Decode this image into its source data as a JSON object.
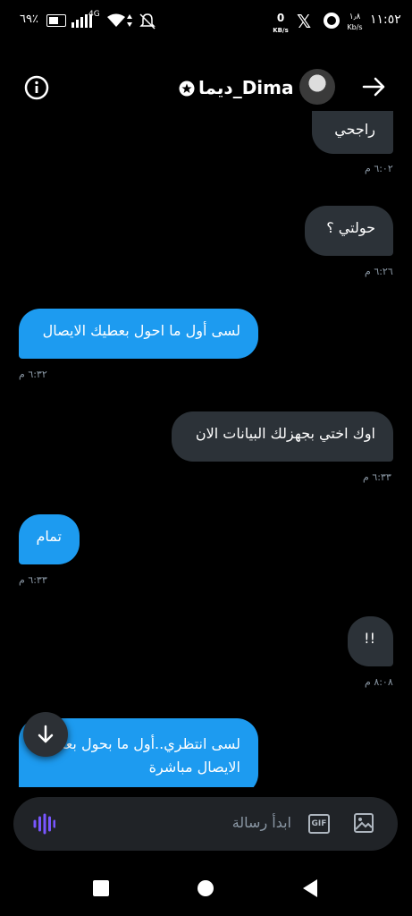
{
  "status_bar": {
    "time": "١١:٥٢",
    "data_speed_value": "١٫٨",
    "data_speed_unit": "Kb/s",
    "data_speed_value2": "0",
    "data_speed_unit2": "KB/s",
    "network": "4G",
    "battery": "٦٩٪"
  },
  "header": {
    "name": "ديما_Dima",
    "info_icon": "info-icon",
    "back_icon": "arrow-right-icon"
  },
  "messages": [
    {
      "dir": "out",
      "text": "راجحي",
      "time": "٦:٠٢ م"
    },
    {
      "dir": "out",
      "text": "حولتي ؟",
      "time": "٦:٢٦ م"
    },
    {
      "dir": "in",
      "text": "لسى أول ما احول بعطيك الايصال",
      "time": "٦:٣٢ م"
    },
    {
      "dir": "out",
      "text": "اوك اختي بجهزلك البيانات الان",
      "time": "٦:٣٣ م"
    },
    {
      "dir": "in",
      "text": "تمام",
      "time": "٦:٣٣ م"
    },
    {
      "dir": "out",
      "text": "!!",
      "time": "٨:٠٨ م"
    },
    {
      "dir": "in",
      "text_line1": "لسى انتظري..أول ما بحول بعطيك",
      "text_line2": "الايصال مباشرة"
    }
  ],
  "composer": {
    "placeholder": "ابدأ رسالة",
    "gif_label": "GIF"
  },
  "colors": {
    "accent": "#1d9bf0",
    "outgoing_bubble": "#2c3238",
    "voice_icon": "#7856ff"
  }
}
